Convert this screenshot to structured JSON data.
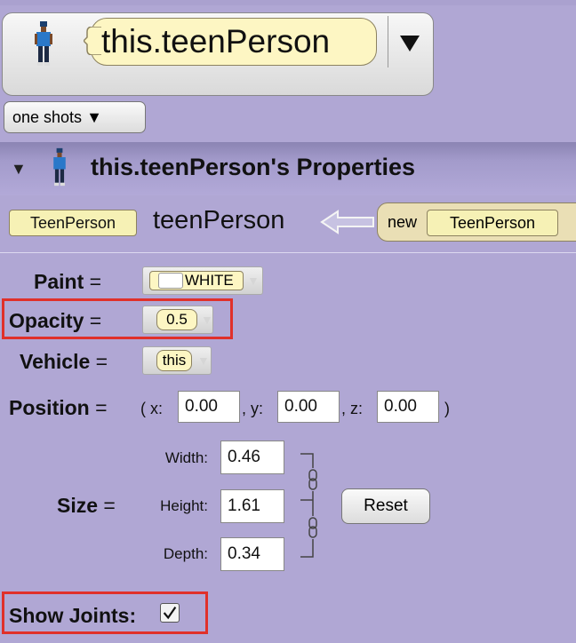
{
  "selector": {
    "value": "this.teenPerson",
    "icon": "person-icon",
    "dropdown_icon": "triangle-down-icon"
  },
  "oneshots": {
    "label": "one shots",
    "arrow": "▼"
  },
  "properties": {
    "title": "this.teenPerson's Properties",
    "toggle": "▼"
  },
  "type_row": {
    "type_tile": "TeenPerson",
    "name": "teenPerson",
    "new_label": "new",
    "new_type": "TeenPerson"
  },
  "paint": {
    "label": "Paint",
    "equals": "=",
    "value": "WHITE"
  },
  "opacity": {
    "label": "Opacity",
    "equals": "=",
    "value": "0.5"
  },
  "vehicle": {
    "label": "Vehicle",
    "equals": "=",
    "value": "this"
  },
  "position": {
    "label": "Position",
    "equals": "=",
    "open": "( x:",
    "x": "0.00",
    "sep_y": ", y:",
    "y": "0.00",
    "sep_z": ", z:",
    "z": "0.00",
    "close": ")"
  },
  "size": {
    "label": "Size",
    "equals": "=",
    "width_label": "Width:",
    "width": "0.46",
    "height_label": "Height:",
    "height": "1.61",
    "depth_label": "Depth:",
    "depth": "0.34",
    "reset_label": "Reset"
  },
  "show_joints": {
    "label": "Show Joints:",
    "checked": true,
    "check_glyph": "✓"
  },
  "colors": {
    "background": "#b0a7d4",
    "tile_yellow": "#fdf6c3",
    "highlight_red": "#e0302a"
  }
}
